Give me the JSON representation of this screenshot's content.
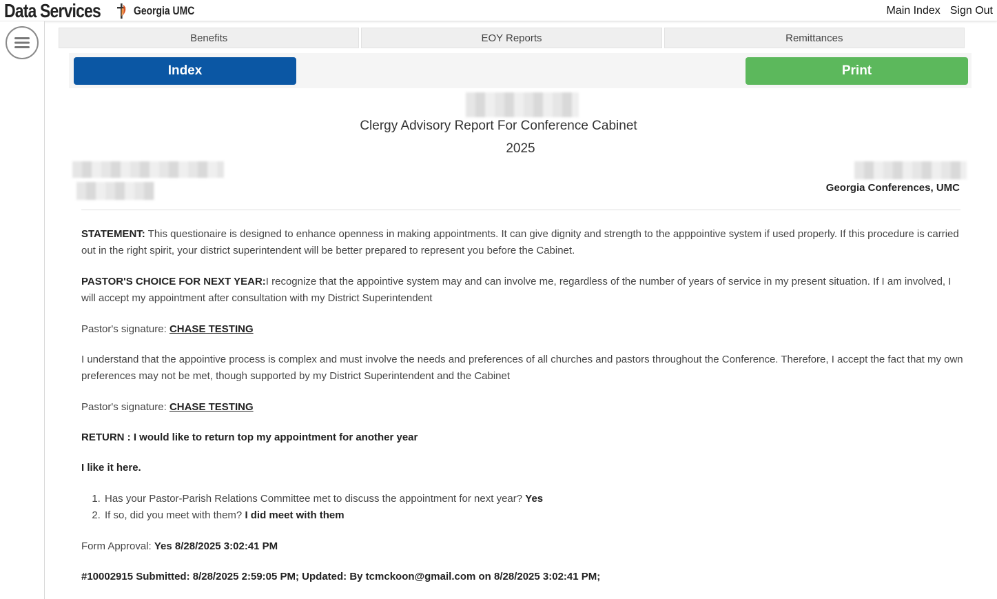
{
  "header": {
    "brand_title": "Data Services",
    "brand_sub": "Georgia UMC",
    "links": {
      "main_index": "Main Index",
      "sign_out": "Sign Out"
    }
  },
  "tabs": [
    {
      "label": "Benefits"
    },
    {
      "label": "EOY Reports"
    },
    {
      "label": "Remittances"
    }
  ],
  "actions": {
    "index_label": "Index",
    "print_label": "Print"
  },
  "report": {
    "title": "Clergy Advisory Report For Conference Cabinet",
    "year": "2025",
    "conference": "Georgia Conferences, UMC"
  },
  "body": {
    "statement_label": "STATEMENT:",
    "statement_text": " This questionaire is designed to enhance openness in making appointments. It can give dignity and strength to the apppointive system if used properly. If this procedure is carried out in the right spirit, your district superintendent will be better prepared to represent you before the Cabinet.",
    "choice_label": "PASTOR'S CHOICE FOR NEXT YEAR:",
    "choice_text": "I recognize that the appointive system may and can involve me, regardless of the number of years of service in my present situation. If I am involved, I will accept my appointment after consultation with my District Superintendent",
    "signature_label": "Pastor's signature: ",
    "signature_value_1": "CHASE TESTING",
    "understand_text": "I understand that the appointive process is complex and must involve the needs and preferences of all churches and pastors throughout the Conference. Therefore, I accept the fact that my own preferences may not be met, though supported by my District Superintendent and the Cabinet",
    "signature_value_2": "CHASE TESTING",
    "return_text": "RETURN : I would like to return top my appointment for another year",
    "comment_text": "I like it here.",
    "questions": [
      {
        "q": "Has your Pastor-Parish Relations Committee met to discuss the appointment for next year? ",
        "a": "Yes"
      },
      {
        "q": "If so, did you meet with them? ",
        "a": "I did meet with them"
      }
    ],
    "approval_label": "Form Approval: ",
    "approval_value": "Yes 8/28/2025 3:02:41 PM",
    "submission_text": "#10002915 Submitted: 8/28/2025 2:59:05 PM; Updated: By tcmckoon@gmail.com on 8/28/2025 3:02:41 PM;"
  },
  "colors": {
    "index_button": "#0b57a4",
    "print_button": "#5cb85c"
  },
  "icons": {
    "menu": "hamburger-menu-icon",
    "logo": "cross-flame-logo"
  }
}
